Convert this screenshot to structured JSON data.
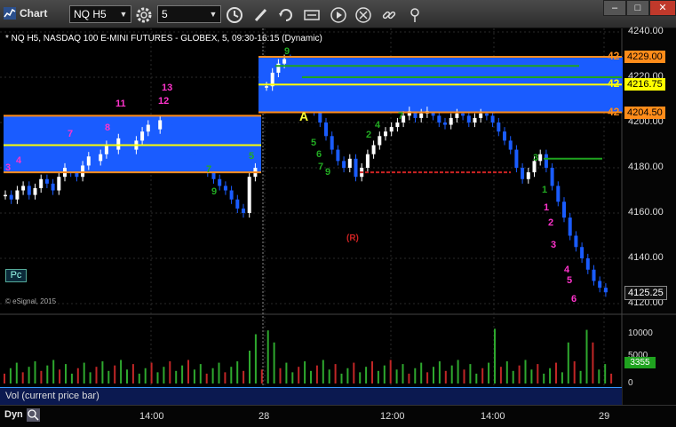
{
  "window": {
    "title": "Chart"
  },
  "toolbar": {
    "symbol": "NQ H5",
    "interval": "5"
  },
  "chart": {
    "header": "* NQ H5, NASDAQ 100 E-MINI FUTURES - GLOBEX, 5, 09:30-16:15 (Dynamic)",
    "copyright": "© eSignal, 2015",
    "pc_label": "Pc",
    "ytick_labels": [
      "4240.00",
      "4220.00",
      "4200.00",
      "4180.00",
      "4160.00",
      "4140.00",
      "4120.00"
    ],
    "price_badges": [
      {
        "label": "4229.00",
        "color": "#ff8c1a"
      },
      {
        "label": "4216.75",
        "color": "#ffff00"
      },
      {
        "label": "4204.50",
        "color": "#ff8c1a"
      },
      {
        "label": "4125.25",
        "color": "#ffffff"
      }
    ],
    "level_tags": [
      {
        "label": "42",
        "color": "#ff8c1a"
      },
      {
        "label": "42",
        "color": "#ffff00"
      },
      {
        "label": "42",
        "color": "#ff8c1a"
      }
    ],
    "annotations": [
      {
        "text": "13",
        "color": "#ff33cc"
      },
      {
        "text": "12",
        "color": "#ff33cc"
      },
      {
        "text": "11",
        "color": "#ff33cc"
      },
      {
        "text": "7",
        "color": "#ff33cc"
      },
      {
        "text": "8",
        "color": "#ff33cc"
      },
      {
        "text": "4",
        "color": "#ff33cc"
      },
      {
        "text": "3",
        "color": "#ff33cc"
      },
      {
        "text": "1",
        "color": "#ff33cc"
      },
      {
        "text": "2",
        "color": "#ff33cc"
      },
      {
        "text": "3",
        "color": "#ff33cc"
      },
      {
        "text": "4",
        "color": "#ff33cc"
      },
      {
        "text": "5",
        "color": "#ff33cc"
      },
      {
        "text": "6",
        "color": "#ff33cc"
      },
      {
        "text": "A",
        "color": "#ffff33"
      },
      {
        "text": "(R)",
        "color": "#cc2222"
      },
      {
        "text": "9",
        "color": "#22aa22"
      },
      {
        "text": "7",
        "color": "#22aa22"
      },
      {
        "text": "5",
        "color": "#22aa22"
      },
      {
        "text": "6",
        "color": "#22aa22"
      },
      {
        "text": "7",
        "color": "#22aa22"
      },
      {
        "text": "9",
        "color": "#22aa22"
      },
      {
        "text": "4",
        "color": "#22aa22"
      },
      {
        "text": "2",
        "color": "#22aa22"
      },
      {
        "text": "1",
        "color": "#22aa22"
      },
      {
        "text": "3",
        "color": "#22aa22"
      },
      {
        "text": "9",
        "color": "#22aa22"
      },
      {
        "text": "5",
        "color": "#22aa22"
      },
      {
        "text": "7",
        "color": "#22aa22"
      }
    ]
  },
  "volume": {
    "label": "Vol (current price bar)",
    "ytick_labels": [
      "10000",
      "5000",
      "0"
    ],
    "current_badge": "3355"
  },
  "xaxis": {
    "ticks": [
      "14:00",
      "28",
      "12:00",
      "14:00",
      "29"
    ]
  },
  "bottom": {
    "dyn_label": "Dyn"
  },
  "colors": {
    "band_blue": "#1a5cff",
    "candle_up": "#ffffff",
    "candle_down": "#1a5cff",
    "vol_up": "#2ea82e",
    "vol_down": "#c02626",
    "orange_level": "#ff8c1a",
    "yellow_level": "#ffff00",
    "green_level": "#1fa31f"
  }
}
